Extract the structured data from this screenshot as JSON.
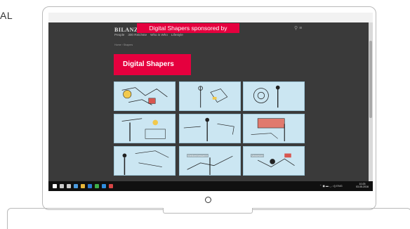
{
  "side_label": "AL",
  "page": {
    "logo": "BILANZ",
    "banner": "Digital Shapers sponsored by",
    "nav": [
      "People",
      "300 Reichste",
      "Who is Who",
      "Lifestyle"
    ],
    "breadcrumb": "Home › Shapers",
    "hero_title": "Digital Shapers",
    "top_icons": "⚲  ≡"
  },
  "tiles": [
    {
      "label": ""
    },
    {
      "label": ""
    },
    {
      "label": ""
    },
    {
      "label": ""
    },
    {
      "label": ""
    },
    {
      "label": ""
    },
    {
      "label": ""
    },
    {
      "label": "Weltverbesserer"
    },
    {
      "label": "Vernetzer"
    }
  ],
  "taskbar": {
    "icons": [
      {
        "name": "windows-start-icon",
        "color": "#ffffff"
      },
      {
        "name": "search-icon",
        "color": "#cccccc"
      },
      {
        "name": "task-view-icon",
        "color": "#cccccc"
      },
      {
        "name": "store-icon",
        "color": "#4b9be0"
      },
      {
        "name": "file-explorer-icon",
        "color": "#e8b63a"
      },
      {
        "name": "edge-icon",
        "color": "#2d7ad6"
      },
      {
        "name": "chrome-icon",
        "color": "#3fae49"
      },
      {
        "name": "photos-icon",
        "color": "#2f8ee0"
      },
      {
        "name": "app-icon",
        "color": "#d64545"
      }
    ],
    "tray": "⌃ ◼ ▬ ◡ ◁) ENG",
    "time": "10:25",
    "date": "03.05.2016"
  },
  "colors": {
    "accent": "#e5003e",
    "page_bg": "#3a3a3a",
    "tile_bg": "#cbe6f2"
  }
}
